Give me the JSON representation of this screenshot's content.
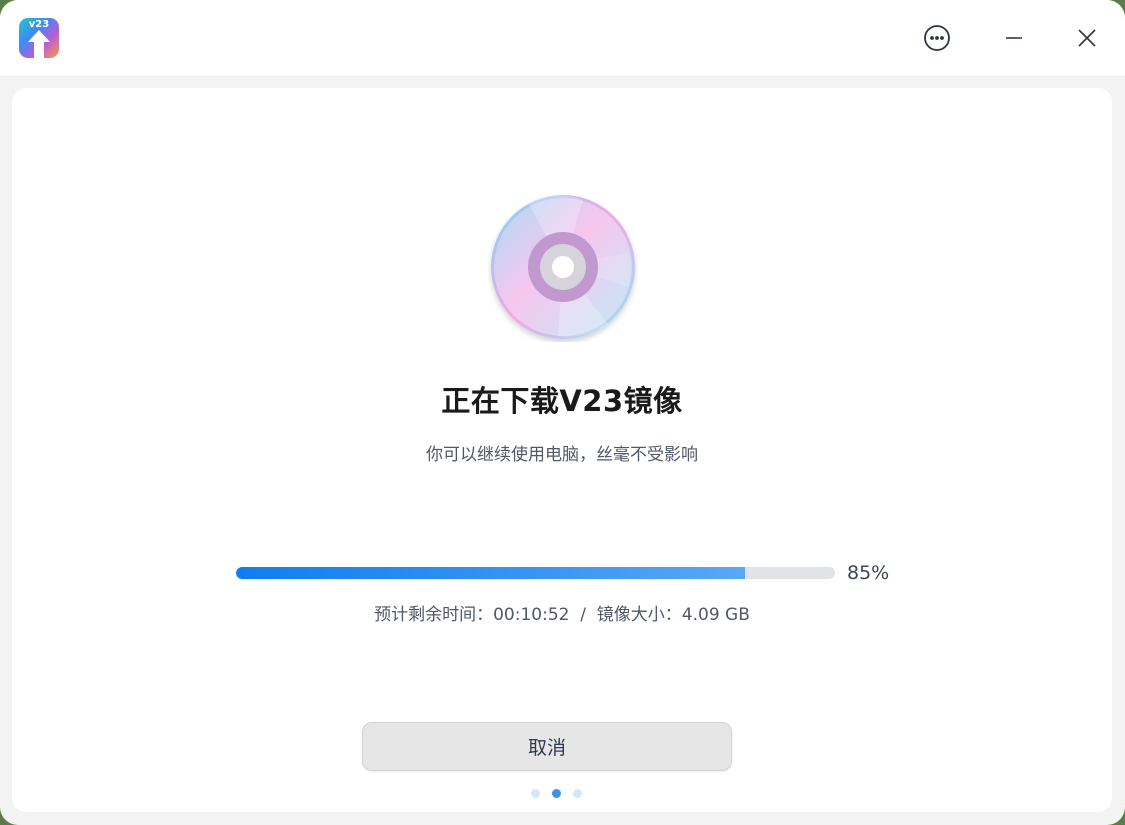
{
  "app": {
    "icon_text": "v23",
    "icon_name": "upgrade-arrow-icon"
  },
  "titlebar": {
    "buttons": [
      {
        "name": "more-options-icon"
      },
      {
        "name": "minimize-icon"
      },
      {
        "name": "close-icon"
      }
    ]
  },
  "main": {
    "illustration": "disc-icon",
    "title": "正在下载V23镜像",
    "subtitle": "你可以继续使用电脑，丝毫不受影响",
    "progress": {
      "value": 85,
      "label": "85%"
    },
    "status": {
      "remaining_label": "预计剩余时间：",
      "remaining_value": "00:10:52",
      "separator": "  /  ",
      "size_label": "镜像大小：",
      "size_value": "4.09 GB"
    },
    "cancel_label": "取消",
    "pager": {
      "count": 3,
      "active": 1
    }
  },
  "colors": {
    "accent": "#1a82f0",
    "progress_track": "#e1e3e6",
    "title_text": "#1a1a1a",
    "secondary_text": "#4f5866"
  }
}
